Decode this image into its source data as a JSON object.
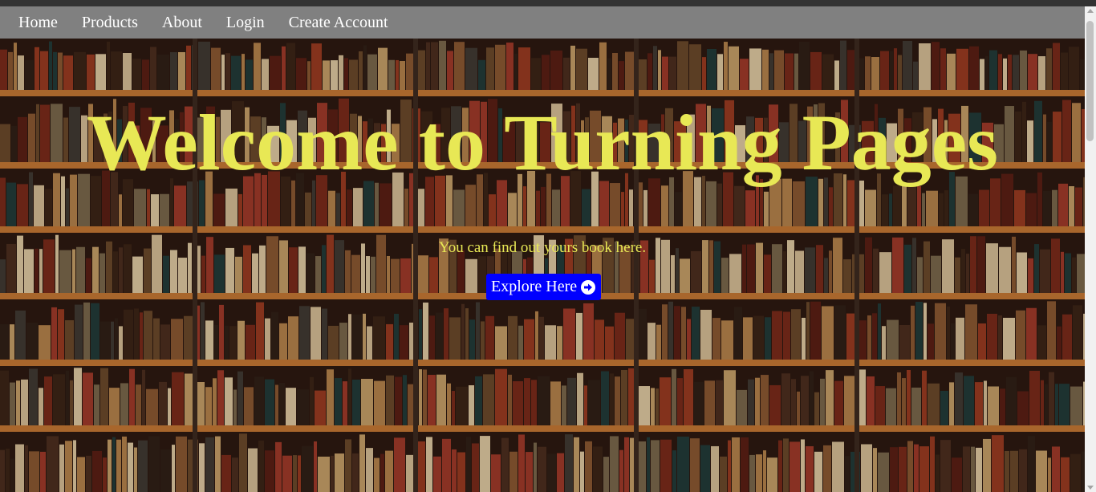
{
  "nav": {
    "items": [
      {
        "label": "Home"
      },
      {
        "label": "Products"
      },
      {
        "label": "About"
      },
      {
        "label": "Login"
      },
      {
        "label": "Create Account"
      }
    ]
  },
  "hero": {
    "title": "Welcome to Turning Pages",
    "subtitle": "You can find out yours book here.",
    "button_label": "Explore Here",
    "button_icon": "arrow-right-icon",
    "background": "bookshelf-photo"
  },
  "colors": {
    "navbar": "#808080",
    "title": "#e8e855",
    "button_bg": "#0000ff",
    "button_text": "#ffffff",
    "shelf_wood": "#c97a35"
  }
}
